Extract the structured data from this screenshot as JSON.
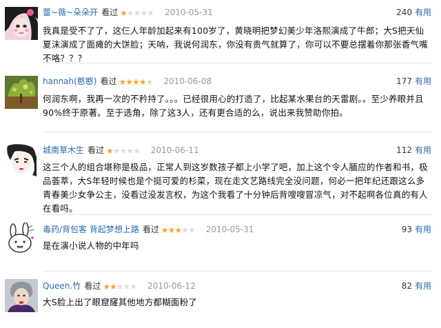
{
  "reviews": [
    {
      "username": "蕾~薇~朵朵开",
      "status": "看过",
      "rating": 1,
      "date": "2010-05-31",
      "useful_count": "240",
      "useful_label": "有用",
      "text": "我真是受不了了，这仨人年龄加起来有100岁了，黄晓明把梦幻美少年洛熙演成了牛郎；大S把天仙夏沫演成了面瘫的大饼脸；天呐，我说何润东，你没有贵气就算了，你可以不要总摆着你那张香气嘴不咯？？？"
    },
    {
      "username": "hannah(憨憨)",
      "status": "看过",
      "rating": 4,
      "date": "2010-06-08",
      "useful_count": "177",
      "useful_label": "有用",
      "text": "何润东啊，我再一次的不矜持了。。。已经很用心的打造了，比起某水果台的天雷剧。。至少养眼并且90%终于原著。至于选角，除了这3人，还有更合适的么，说出来我赞助你拍。"
    },
    {
      "username": "城南草木生",
      "status": "看过",
      "rating": 1,
      "date": "2010-06-11",
      "useful_count": "112",
      "useful_label": "有用",
      "text": "这三个人的组合堪称是极品，正常人到这岁数孩子都上小学了吧，加上这个令人腼应的作者和书，极品荟萃，大S年轻时候也是个挺可爱的杉菜，现在走文艺路线完全没问题，何必一把年纪还跟这么多青春美少女争公主，没看过没发言权，为这个我看了十分钟后背嗖嗖冒凉气，对不起啊各位真的有人在看吗。"
    },
    {
      "username": "毒药/背包客 背起梦想上路",
      "status": "看过",
      "rating": 3,
      "date": "2010-05-31",
      "useful_count": "93",
      "useful_label": "有用",
      "text": "是在演小说人物的中年吗"
    },
    {
      "username": "Queen.竹",
      "status": "看过",
      "rating": 2,
      "date": "2010-06-12",
      "useful_count": "82",
      "useful_label": "有用",
      "text": "大S脸上出了眼窟窿其他地方都糊面粉了"
    }
  ],
  "colors": {
    "username": "#2a6aad",
    "star_on": "#f7a529",
    "star_off": "#dcdcdc",
    "date": "#999999"
  }
}
